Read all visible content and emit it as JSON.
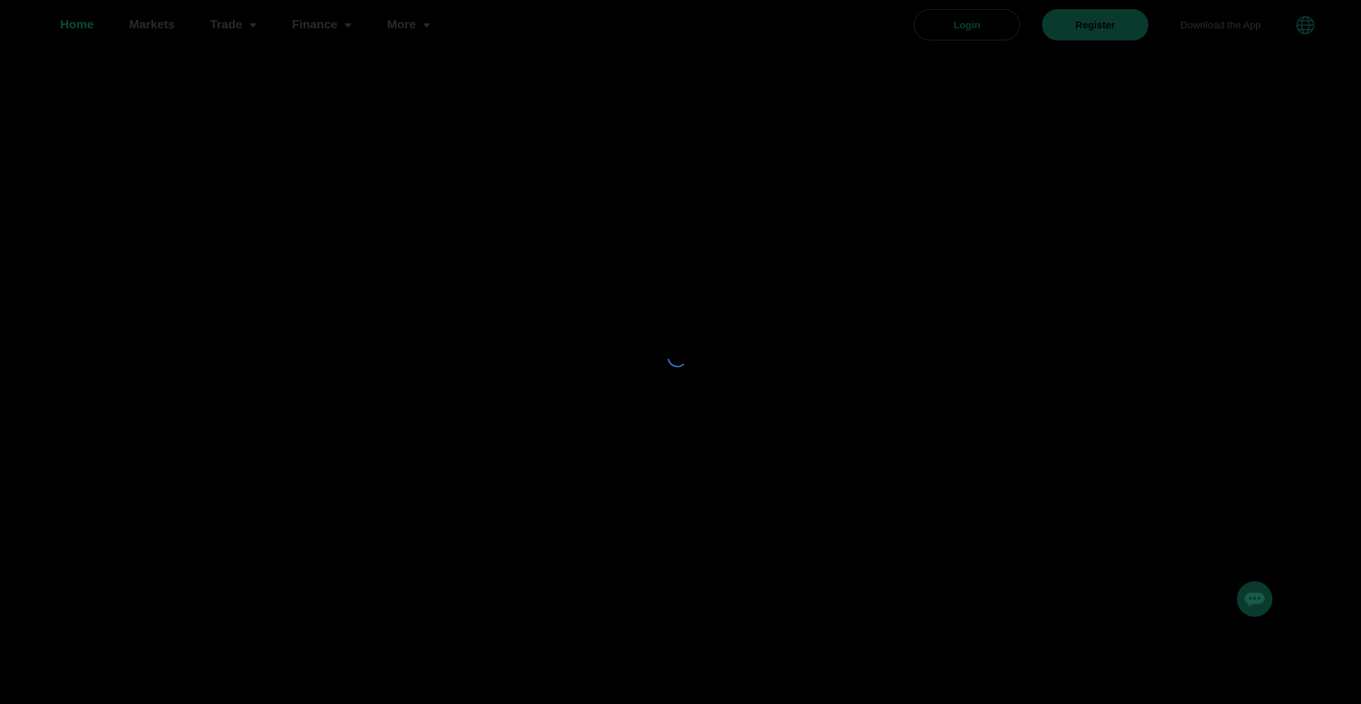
{
  "nav": {
    "items": [
      {
        "label": "Home",
        "active": true,
        "dropdown": false
      },
      {
        "label": "Markets",
        "active": false,
        "dropdown": false
      },
      {
        "label": "Trade",
        "active": false,
        "dropdown": true
      },
      {
        "label": "Finance",
        "active": false,
        "dropdown": true
      },
      {
        "label": "More",
        "active": false,
        "dropdown": true
      }
    ]
  },
  "header": {
    "login_label": "Login",
    "register_label": "Register",
    "download_label": "Download the App",
    "language_icon": "globe-icon"
  },
  "loader": {
    "icon": "loading-spinner-icon",
    "color": "#3b7bd6"
  },
  "chat": {
    "icon": "chat-bubble-icon"
  },
  "colors": {
    "background": "#000000",
    "accent": "#0a3a2e",
    "active_nav": "#0b4a3a",
    "muted_text": "#2a2a2a"
  }
}
